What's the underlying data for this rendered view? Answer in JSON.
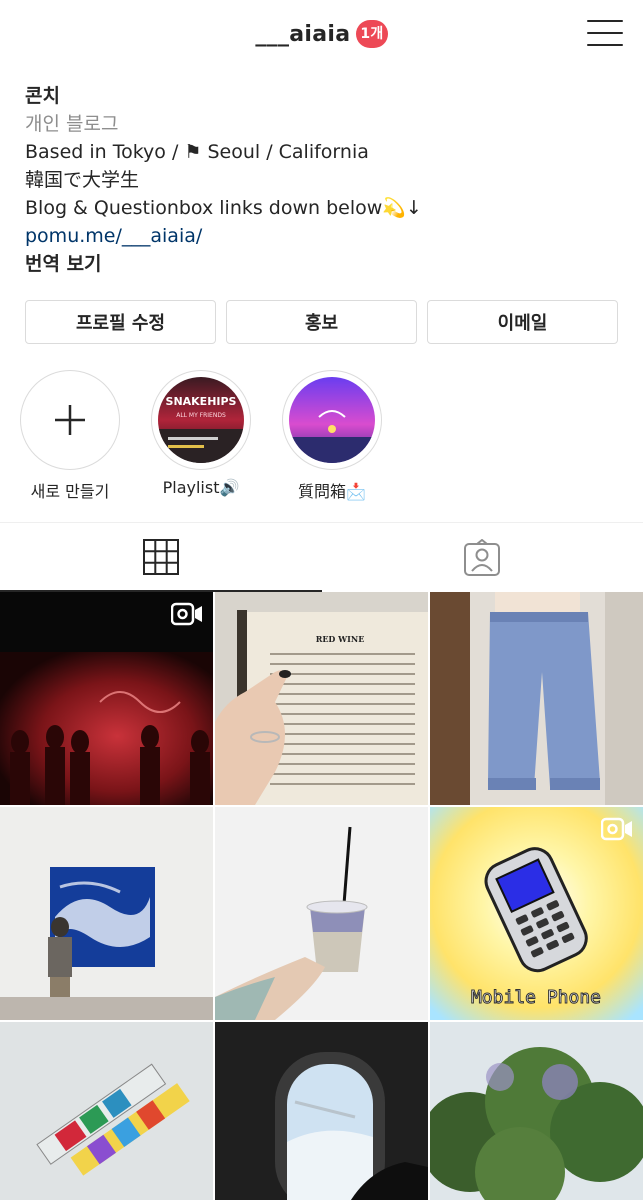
{
  "header": {
    "username": "___aiaia",
    "badge": "1개"
  },
  "bio": {
    "name": "콘치",
    "category": "개인 블로그",
    "line1": "Based in Tokyo / ⚑ Seoul / California",
    "line2": "韓国で大学生",
    "line3": "Blog & Questionbox links down below💫↓",
    "link": "pomu.me/___aiaia/",
    "translate": "번역 보기"
  },
  "actions": {
    "edit_profile": "프로필 수정",
    "promote": "홍보",
    "email": "이메일"
  },
  "highlights": [
    {
      "label": "새로 만들기",
      "icon": "plus-icon"
    },
    {
      "label": "Playlist🔊"
    },
    {
      "label": "質問箱📩"
    }
  ],
  "highlight_art": {
    "playlist_title": "SNAKEHIPS",
    "playlist_sub": "ALL MY FRIENDS"
  },
  "tabs": [
    {
      "name": "grid",
      "icon": "grid-icon",
      "active": true
    },
    {
      "name": "tagged",
      "icon": "tagged-person-icon",
      "active": false
    }
  ],
  "posts": [
    {
      "desc": "concert video",
      "video": true
    },
    {
      "desc": "red wine menu",
      "video": false,
      "text": "RED WINE"
    },
    {
      "desc": "blue pants",
      "video": false
    },
    {
      "desc": "blue painting gallery",
      "video": false
    },
    {
      "desc": "iced drink",
      "video": false
    },
    {
      "desc": "mobile phone",
      "video": true,
      "text": "Mobile Phone"
    },
    {
      "desc": "candy wrappers",
      "video": false
    },
    {
      "desc": "airplane window",
      "video": false
    },
    {
      "desc": "trees",
      "video": false
    }
  ]
}
